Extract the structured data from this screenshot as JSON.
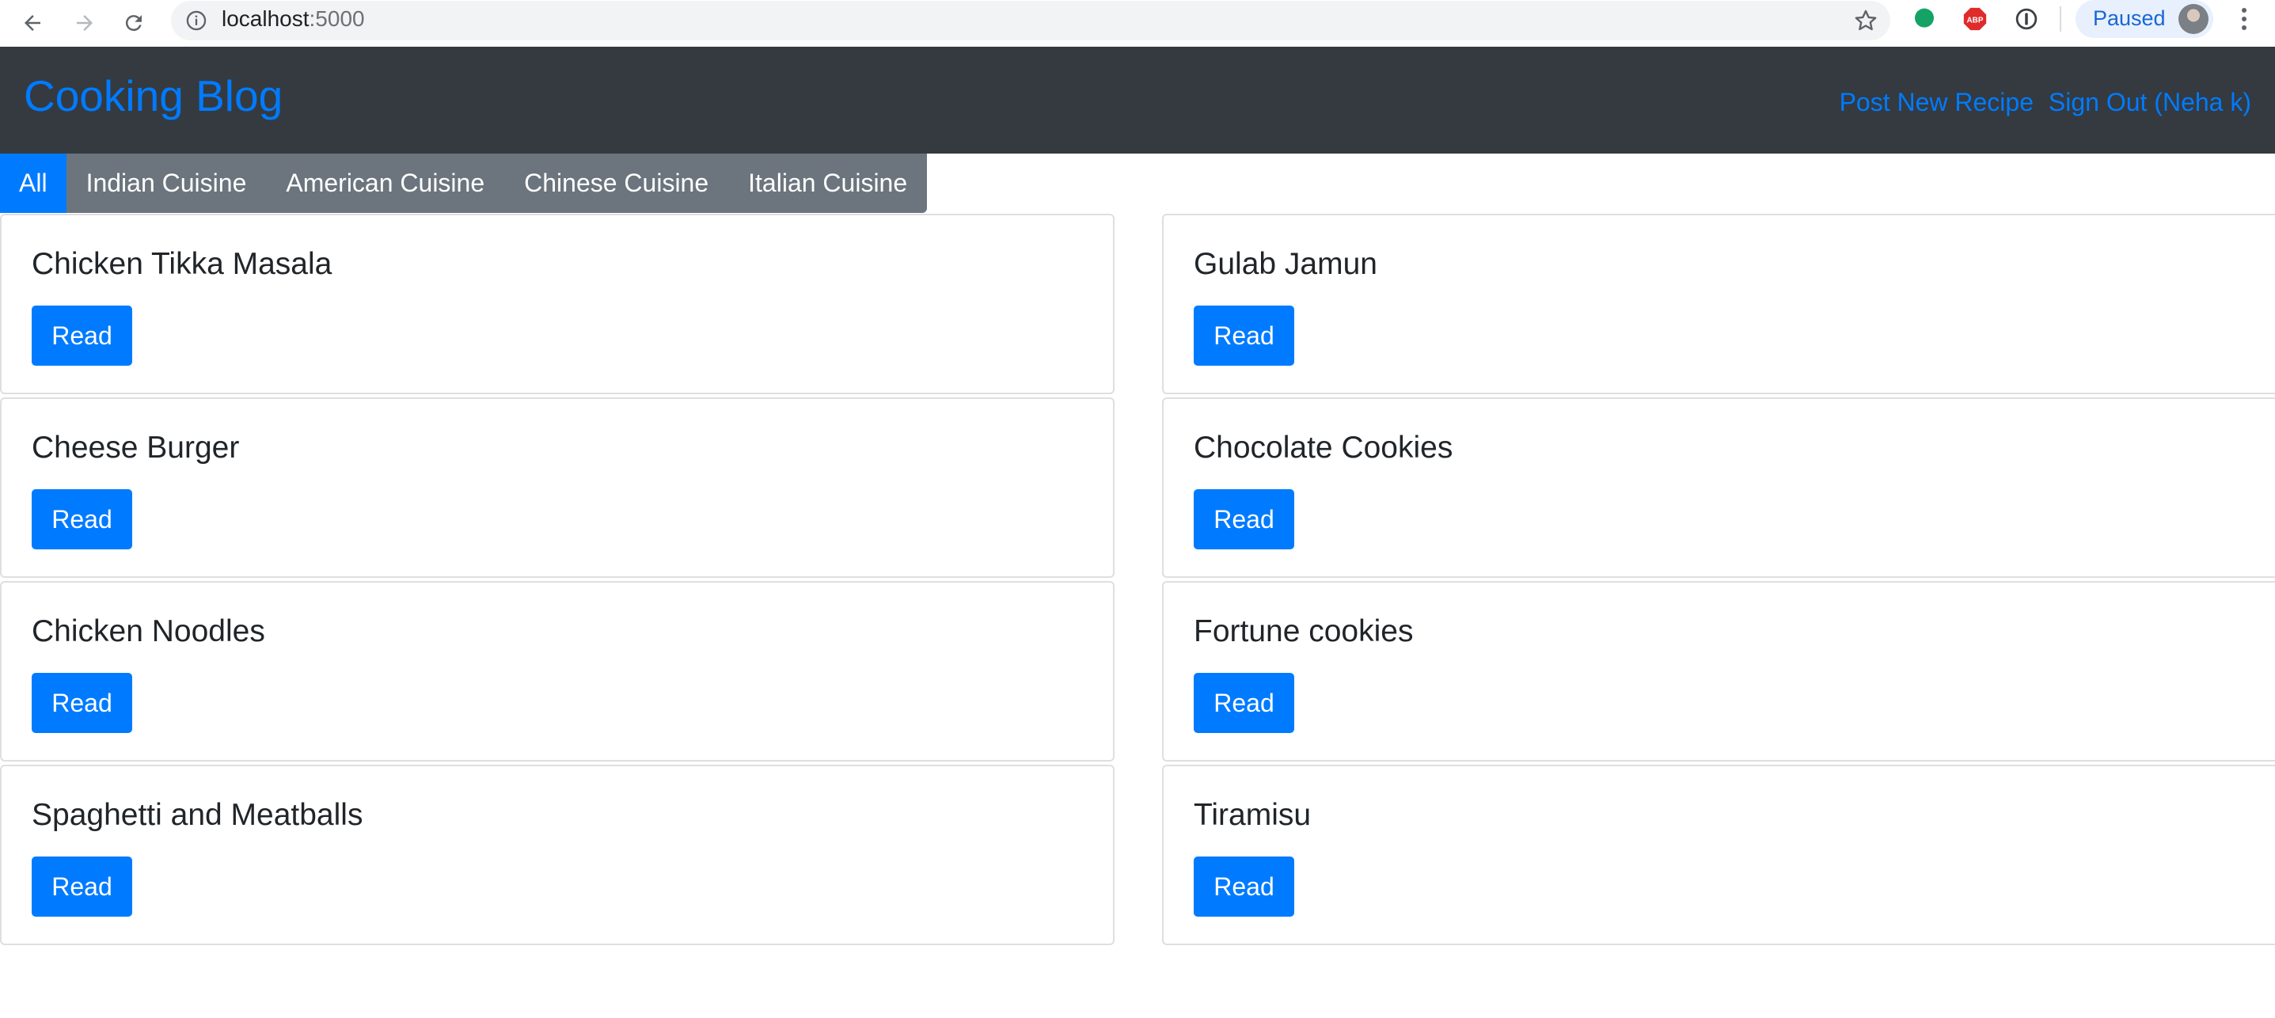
{
  "browser": {
    "url_host": "localhost",
    "url_port": ":5000",
    "profile_status": "Paused",
    "icons": [
      "back-icon",
      "forward-icon",
      "reload-icon",
      "info-icon",
      "star-icon",
      "grammarly-icon",
      "adblock-icon",
      "extension-icon",
      "avatar",
      "menu-icon"
    ],
    "adblock_label": "ABP"
  },
  "site": {
    "brand": "Cooking Blog",
    "nav": {
      "post_new": "Post New Recipe",
      "sign_out": "Sign Out (Neha k)"
    },
    "colors": {
      "navbar": "#343a40",
      "accent": "#007bff",
      "tabs": "#6c757d"
    }
  },
  "tabs": [
    "All",
    "Indian Cuisine",
    "American Cuisine",
    "Chinese Cuisine",
    "Italian Cuisine"
  ],
  "active_tab": "All",
  "recipes": [
    {
      "title": "Chicken Tikka Masala",
      "button": "Read"
    },
    {
      "title": "Gulab Jamun",
      "button": "Read"
    },
    {
      "title": "Cheese Burger",
      "button": "Read"
    },
    {
      "title": "Chocolate Cookies",
      "button": "Read"
    },
    {
      "title": "Chicken Noodles",
      "button": "Read"
    },
    {
      "title": "Fortune cookies",
      "button": "Read"
    },
    {
      "title": "Spaghetti and Meatballs",
      "button": "Read"
    },
    {
      "title": "Tiramisu",
      "button": "Read"
    }
  ]
}
